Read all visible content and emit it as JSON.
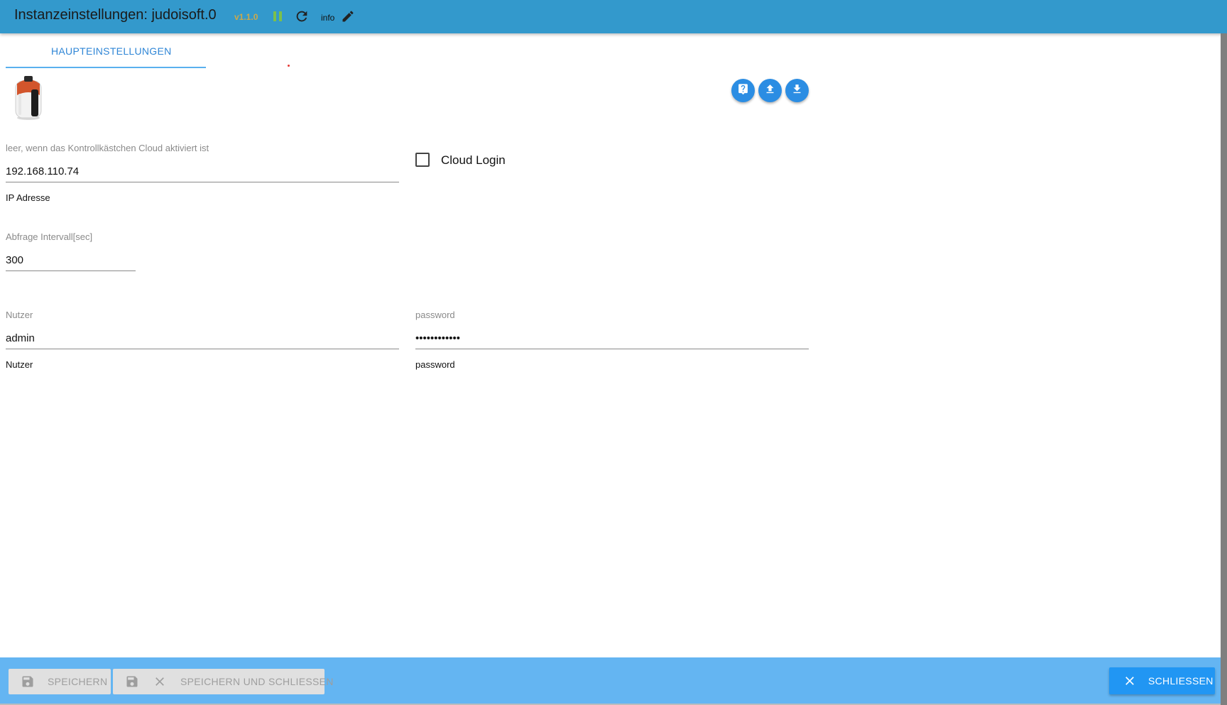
{
  "header": {
    "title": "Instanzeinstellungen: judoisoft.0",
    "version": "v1.1.0",
    "loglevel": "info",
    "pause_icon": "pause-icon",
    "reload_icon": "reload-icon",
    "edit_icon": "pencil-icon"
  },
  "tabs": [
    {
      "label": "HAUPTEINSTELLUNGEN",
      "active": true
    }
  ],
  "toolbar": {
    "help_icon": "help-icon",
    "upload_icon": "upload-icon",
    "download_icon": "download-icon"
  },
  "form": {
    "ip": {
      "label": "leer, wenn das Kontrollkästchen Cloud aktiviert ist",
      "value": "192.168.110.74",
      "help": "IP Adresse"
    },
    "interval": {
      "label": "Abfrage Intervall[sec]",
      "value": "300"
    },
    "cloud": {
      "label": "Cloud Login",
      "checked": false
    },
    "user": {
      "label": "Nutzer",
      "value": "admin",
      "help": "Nutzer"
    },
    "password": {
      "label": "password",
      "value": "••••••••••••",
      "help": "password"
    }
  },
  "footer": {
    "save_label": "SPEICHERN",
    "save_close_label": "SPEICHERN UND SCHLIESSEN",
    "close_label": "SCHLIESSEN"
  },
  "colors": {
    "header": "#3399cc",
    "footer": "#64b5f2",
    "accent": "#2196f3",
    "version": "#cda94a",
    "pause": "#7cc04b"
  }
}
